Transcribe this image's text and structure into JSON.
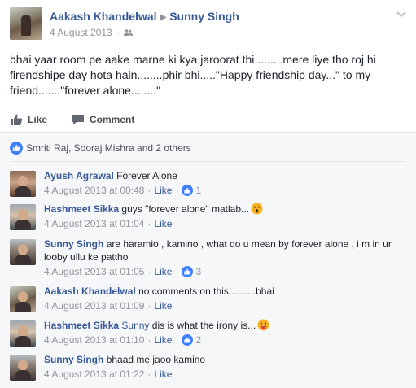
{
  "post": {
    "author": "Aakash Khandelwal",
    "target": "Sunny Singh",
    "date": "4 August 2013",
    "meta_sep": "·",
    "text": "bhai yaar room pe aake marne ki kya jaroorat thi ........mere liye tho roj hi firendshipe day hota hain........phir bhi.....\"Happy friendship day...\" to my friend.......\"forever alone........\""
  },
  "actions": {
    "like_label": "Like",
    "comment_label": "Comment"
  },
  "likes_summary": "Smriti Raj, Sooraj Mishra and 2 others",
  "comments": [
    {
      "author": "Ayush Agrawal",
      "text": "Forever Alone",
      "time": "4 August 2013 at 00:48",
      "like_label": "Like",
      "likes": "1"
    },
    {
      "author": "Hashmeet Sikka",
      "text": "guys \"forever alone\" matlab...",
      "emoji": "surprised",
      "time": "4 August 2013 at 01:04",
      "like_label": "Like"
    },
    {
      "author": "Sunny Singh",
      "text": "are haramio , kamino , what do u mean by forever alone , i m in ur looby ullu ke pattho",
      "time": "4 August 2013 at 01:05",
      "like_label": "Like",
      "likes": "3"
    },
    {
      "author": "Aakash Khandelwal",
      "text": "no comments on this..........bhai",
      "time": "4 August 2013 at 01:09",
      "like_label": "Like"
    },
    {
      "author": "Hashmeet Sikka",
      "tag": "Sunny",
      "text": "dis is what the irony is...",
      "emoji": "tongue",
      "time": "4 August 2013 at 01:10",
      "like_label": "Like",
      "likes": "2"
    },
    {
      "author": "Sunny Singh",
      "text": "bhaad me jaoo kamino",
      "time": "4 August 2013 at 01:22",
      "like_label": "Like"
    }
  ],
  "colors": {
    "link": "#365899",
    "meta": "#90949c",
    "like_blue": "#4080ff",
    "background": "#f6f7f9"
  }
}
